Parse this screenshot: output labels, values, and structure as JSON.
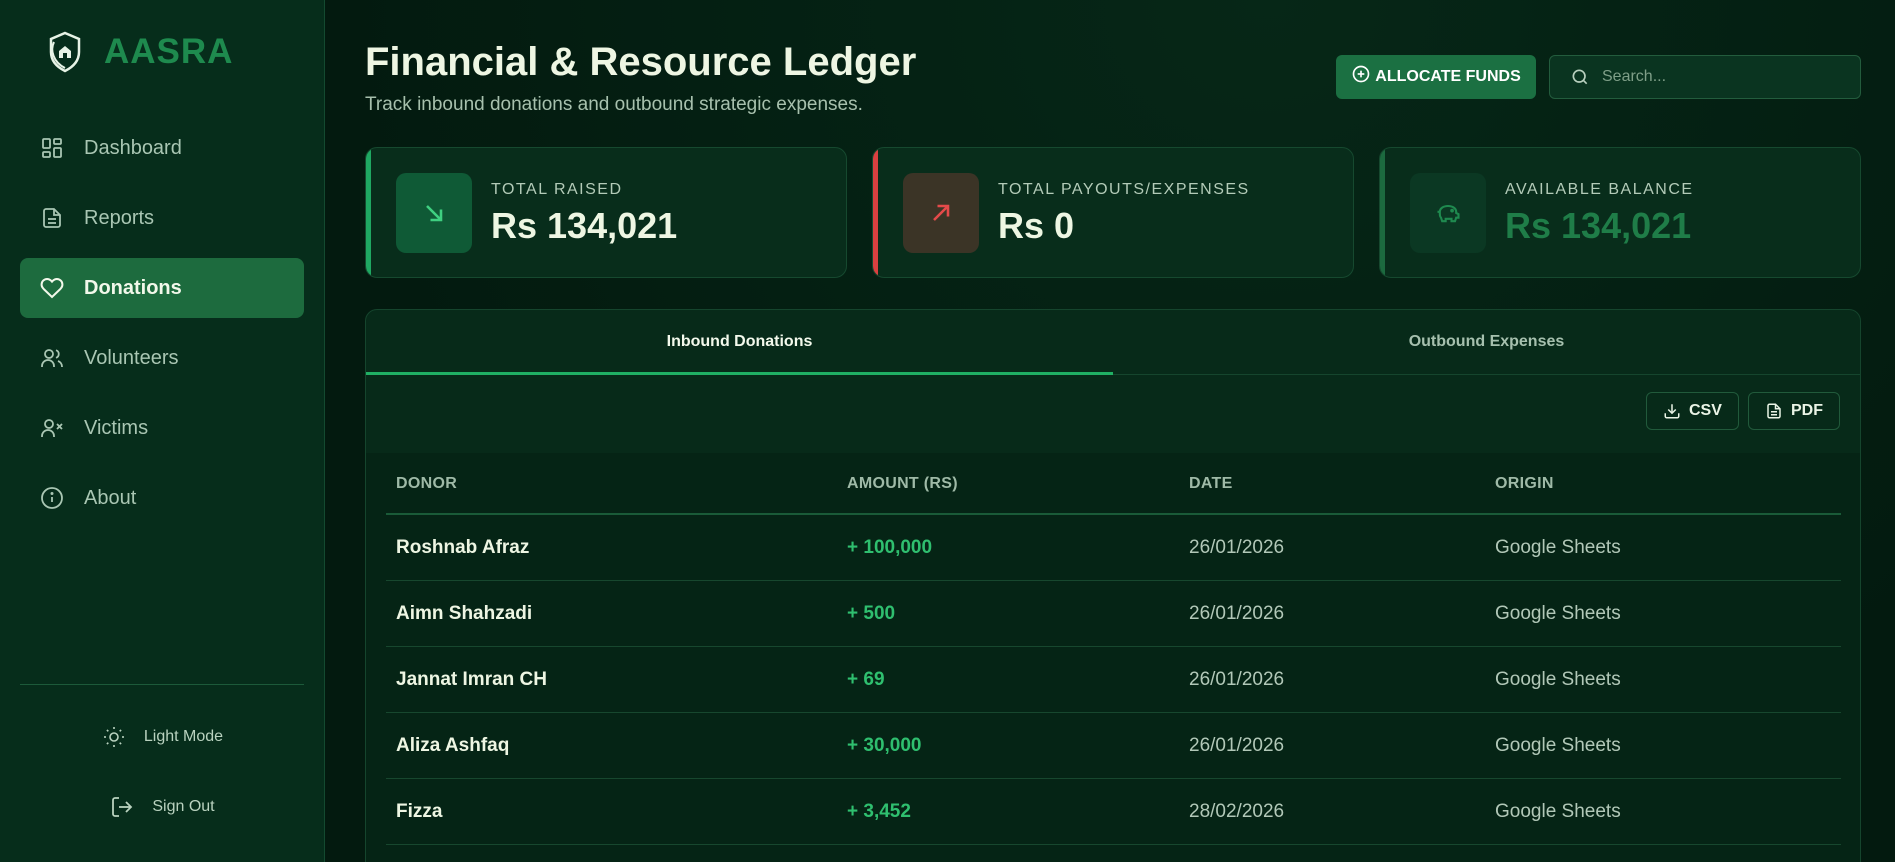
{
  "brand": {
    "name": "AASRA"
  },
  "sidebar": {
    "items": [
      {
        "label": "Dashboard",
        "icon": "dashboard-icon",
        "active": false
      },
      {
        "label": "Reports",
        "icon": "file-text-icon",
        "active": false
      },
      {
        "label": "Donations",
        "icon": "heart-icon",
        "active": true
      },
      {
        "label": "Volunteers",
        "icon": "users-icon",
        "active": false
      },
      {
        "label": "Victims",
        "icon": "user-x-icon",
        "active": false
      },
      {
        "label": "About",
        "icon": "info-icon",
        "active": false
      }
    ],
    "light_mode_label": "Light Mode",
    "sign_out_label": "Sign Out"
  },
  "header": {
    "title": "Financial & Resource Ledger",
    "subtitle": "Track inbound donations and outbound strategic expenses.",
    "allocate_label": "ALLOCATE FUNDS",
    "search_placeholder": "Search..."
  },
  "stats": [
    {
      "label": "TOTAL RAISED",
      "value": "Rs 134,021",
      "icon": "arrow-down-right-icon",
      "accent": "#1fa862"
    },
    {
      "label": "TOTAL PAYOUTS/EXPENSES",
      "value": "Rs 0",
      "icon": "arrow-up-right-icon",
      "accent": "#d94040"
    },
    {
      "label": "AVAILABLE BALANCE",
      "value": "Rs 134,021",
      "icon": "piggy-bank-icon",
      "accent": "#1c6a3f"
    }
  ],
  "tabs": [
    {
      "label": "Inbound Donations",
      "active": true
    },
    {
      "label": "Outbound Expenses",
      "active": false
    }
  ],
  "toolbar": {
    "csv_label": "CSV",
    "pdf_label": "PDF"
  },
  "table": {
    "columns": [
      "DONOR",
      "AMOUNT (RS)",
      "DATE",
      "ORIGIN"
    ],
    "rows": [
      {
        "donor": "Roshnab Afraz",
        "amount": "+ 100,000",
        "date": "26/01/2026",
        "origin": "Google Sheets"
      },
      {
        "donor": "Aimn Shahzadi",
        "amount": "+ 500",
        "date": "26/01/2026",
        "origin": "Google Sheets"
      },
      {
        "donor": "Jannat Imran CH",
        "amount": "+ 69",
        "date": "26/01/2026",
        "origin": "Google Sheets"
      },
      {
        "donor": "Aliza Ashfaq",
        "amount": "+ 30,000",
        "date": "26/01/2026",
        "origin": "Google Sheets"
      },
      {
        "donor": "Fizza",
        "amount": "+ 3,452",
        "date": "28/02/2026",
        "origin": "Google Sheets"
      }
    ]
  },
  "colors": {
    "accent_green": "#1d6b3e",
    "positive": "#2fbf6f",
    "negative": "#d94040"
  }
}
